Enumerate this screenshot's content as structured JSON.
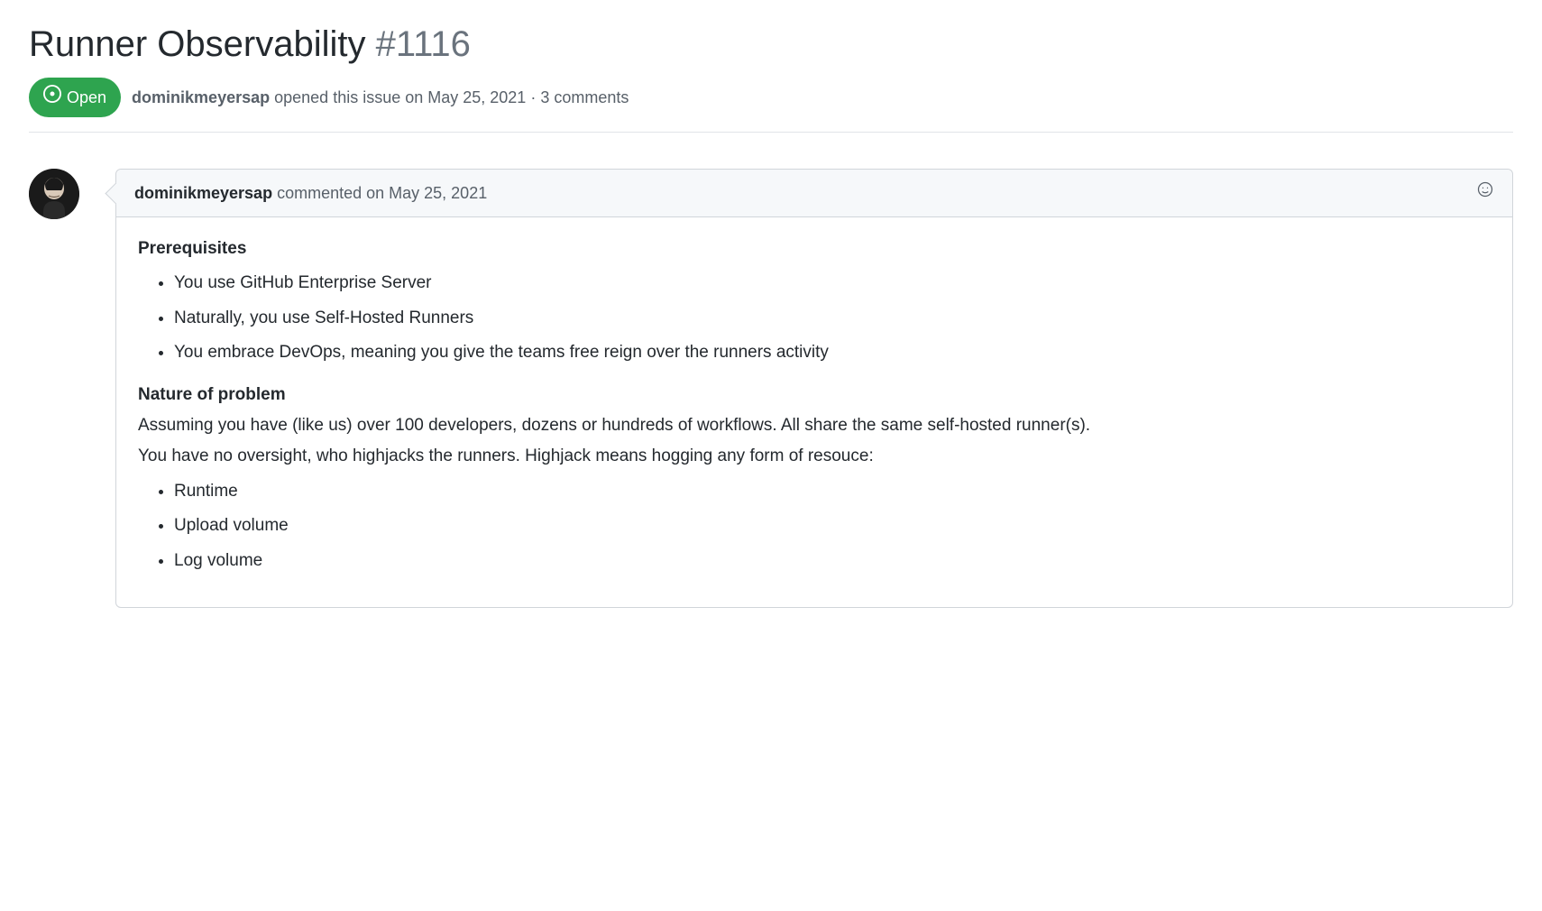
{
  "issue": {
    "title": "Runner Observability",
    "number": "#1116",
    "state": "Open",
    "author": "dominikmeyersap",
    "opened_text": "opened this issue on May 25, 2021",
    "separator": "·",
    "comments_count": "3 comments"
  },
  "comment": {
    "author": "dominikmeyersap",
    "commented_text": "commented on May 25, 2021",
    "sections": {
      "prerequisites": {
        "title": "Prerequisites",
        "items": [
          "You use GitHub Enterprise Server",
          "Naturally, you use Self-Hosted Runners",
          "You embrace DevOps, meaning you give the teams free reign over the runners activity"
        ]
      },
      "nature": {
        "title": "Nature of problem",
        "para1": "Assuming you have (like us) over 100 developers, dozens or hundreds of workflows. All share the same self-hosted runner(s).",
        "para2": "You have no oversight, who highjacks the runners. Highjack means hogging any form of resouce:",
        "items": [
          "Runtime",
          "Upload volume",
          "Log volume"
        ]
      }
    }
  }
}
